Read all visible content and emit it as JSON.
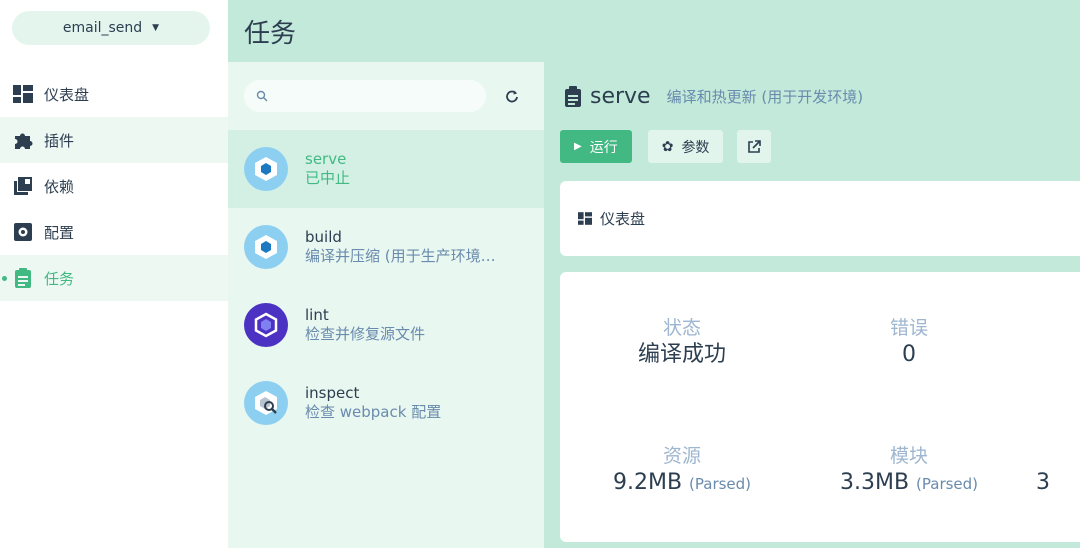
{
  "sidebar": {
    "project": "email_send",
    "items": [
      {
        "label": "仪表盘",
        "icon": "dashboard-icon"
      },
      {
        "label": "插件",
        "icon": "puzzle-icon"
      },
      {
        "label": "依赖",
        "icon": "library-icon"
      },
      {
        "label": "配置",
        "icon": "settings-icon"
      },
      {
        "label": "任务",
        "icon": "assignment-icon"
      }
    ]
  },
  "header": {
    "title": "任务"
  },
  "tasks": {
    "search_placeholder": "",
    "items": [
      {
        "name": "serve",
        "desc": "已中止"
      },
      {
        "name": "build",
        "desc": "编译并压缩 (用于生产环境…"
      },
      {
        "name": "lint",
        "desc": "检查并修复源文件"
      },
      {
        "name": "inspect",
        "desc": "检查 webpack 配置"
      }
    ]
  },
  "detail": {
    "name": "serve",
    "desc": "编译和热更新 (用于开发环境)",
    "run_label": "运行",
    "params_label": "参数",
    "dashboard_label": "仪表盘",
    "stats": {
      "status_label": "状态",
      "status_value": "编译成功",
      "errors_label": "错误",
      "errors_value": "0",
      "assets_label": "资源",
      "assets_value": "9.2MB",
      "assets_unit": "(Parsed)",
      "modules_label": "模块",
      "modules_value": "3.3MB",
      "modules_unit": "(Parsed)",
      "cutoff_value": "3"
    }
  },
  "colors": {
    "accent": "#42b983",
    "header_bg": "#c2e9d9",
    "list_bg": "#e8f7f0",
    "text": "#2c3e50",
    "muted": "#6a8bad"
  }
}
